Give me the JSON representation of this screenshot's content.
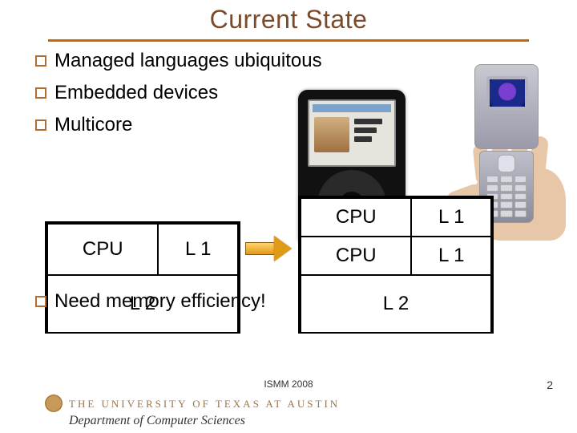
{
  "title": "Current State",
  "bullets": {
    "b1": "Managed languages ubiquitous",
    "b2": "Embedded devices",
    "b3": "Multicore",
    "need": "Need memory efficiency!"
  },
  "cpu": {
    "cpu": "CPU",
    "l1": "L 1",
    "l2": "L 2"
  },
  "footer": {
    "venue": "ISMM 2008",
    "page": "2",
    "university": "THE UNIVERSITY OF TEXAS AT AUSTIN",
    "dept": "Department of Computer Sciences"
  }
}
